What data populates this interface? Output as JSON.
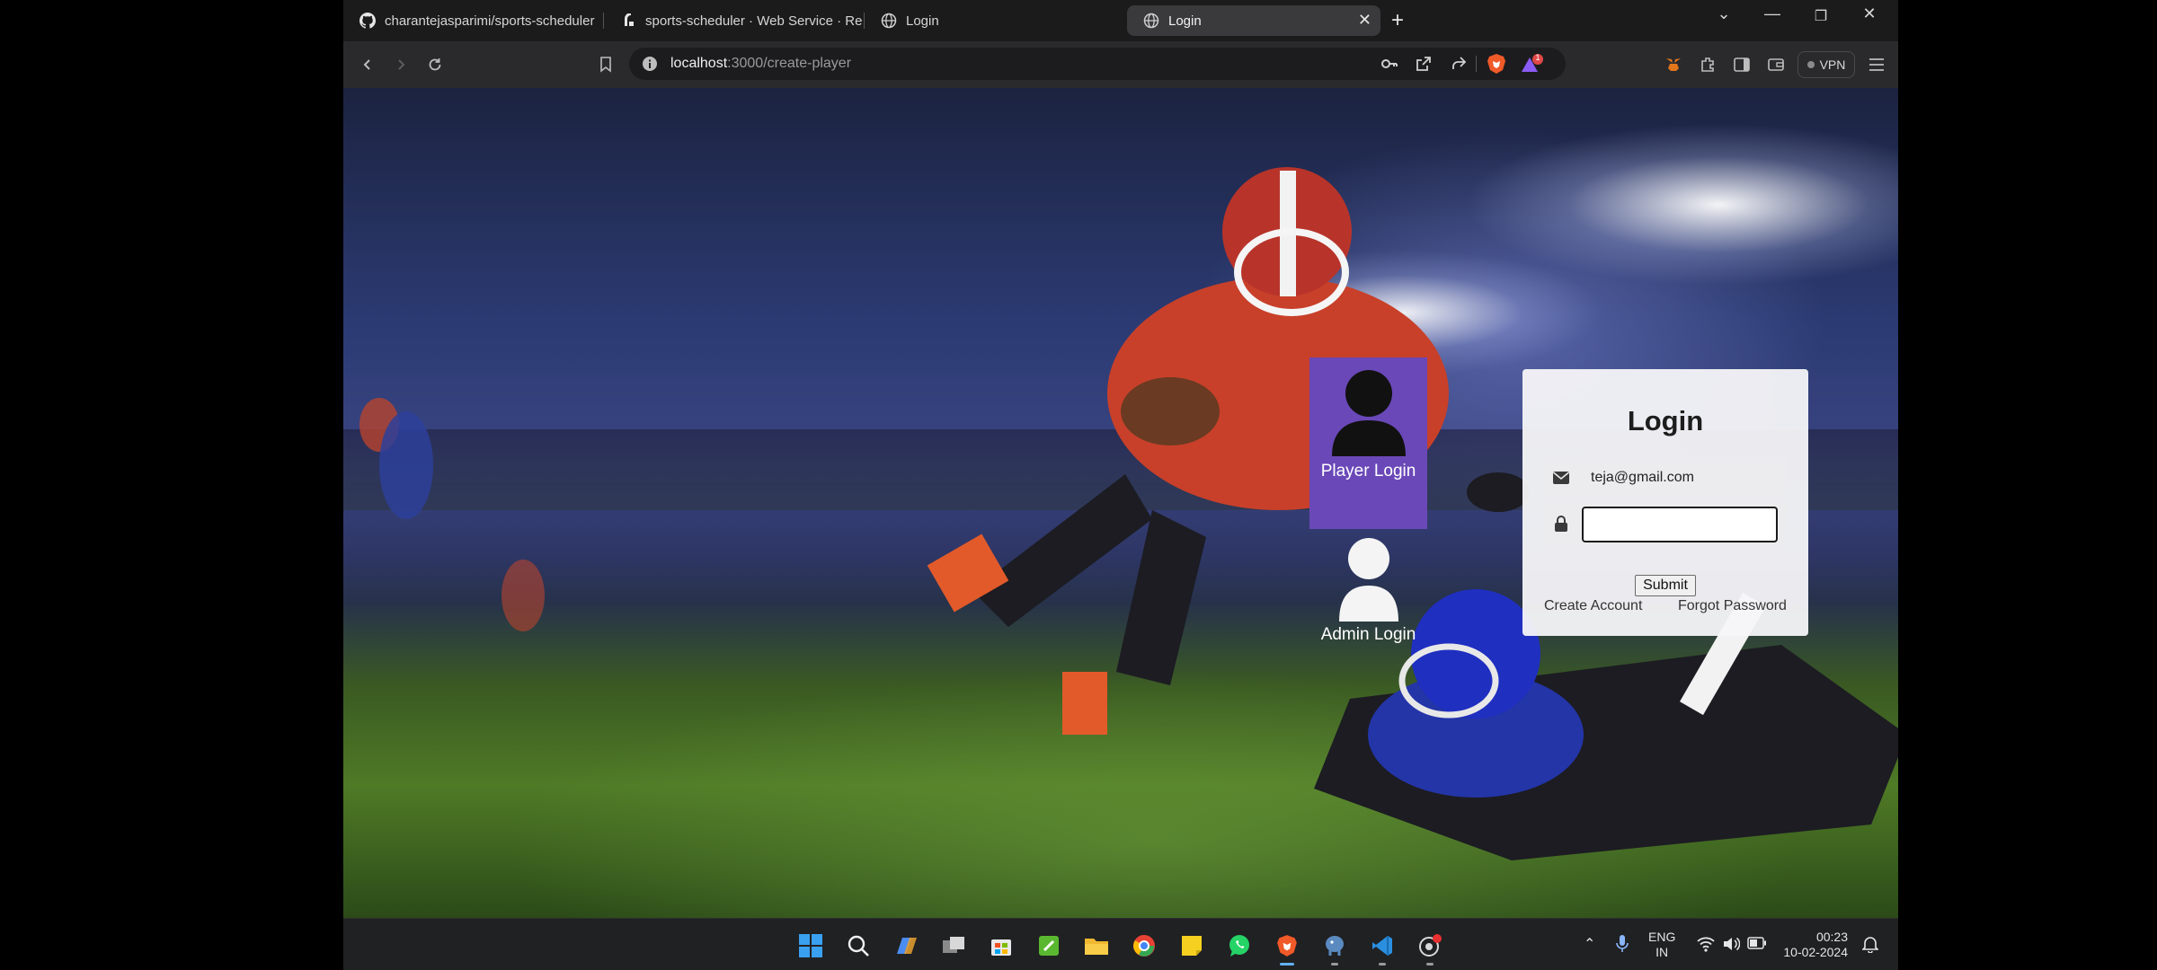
{
  "browser": {
    "tabs": [
      {
        "title": "charantejasparimi/sports-scheduler",
        "icon": "github-icon"
      },
      {
        "title": "sports-scheduler · Web Service · Re",
        "icon": "render-icon"
      },
      {
        "title": "Login",
        "icon": "globe-icon"
      },
      {
        "title": "Login",
        "icon": "globe-icon",
        "active": true
      }
    ],
    "url_host": "localhost",
    "url_path": ":3000/create-player",
    "vpn_label": "VPN",
    "notification_badge": "1"
  },
  "page": {
    "player_login_label": "Player Login",
    "admin_login_label": "Admin Login",
    "login_title": "Login",
    "email_value": "teja@gmail.com",
    "password_value": "",
    "submit_label": "Submit",
    "create_account_label": "Create Account",
    "forgot_password_label": "Forgot Password",
    "player_card_color": "#6a48b8"
  },
  "taskbar": {
    "lang_line1": "ENG",
    "lang_line2": "IN",
    "time": "00:23",
    "date": "10-02-2024"
  }
}
